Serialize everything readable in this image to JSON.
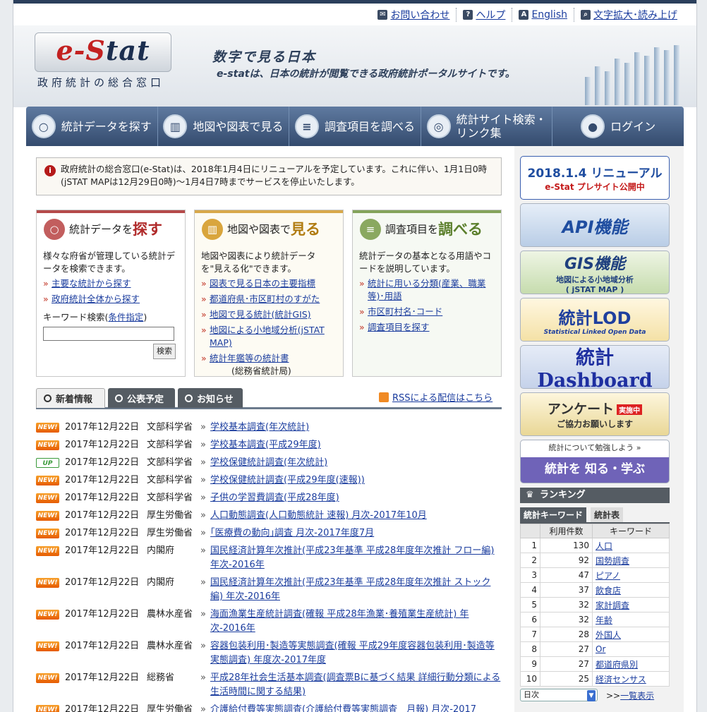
{
  "util": [
    {
      "icon": "✉",
      "label": "お問い合わせ"
    },
    {
      "icon": "?",
      "label": "ヘルプ"
    },
    {
      "icon": "A",
      "label": "English"
    },
    {
      "icon": "⌕",
      "label": "文字拡大･読み上げ"
    }
  ],
  "header": {
    "logo_text_pre": "e-S",
    "logo_text_post": "tat",
    "logo_sub": "政府統計の総合窓口",
    "tagline": "数字で見る日本",
    "tagline2": "e-statは、日本の統計が閲覧できる政府統計ポータルサイトです。"
  },
  "nav": [
    {
      "icon": "search-icon",
      "glyph": "○",
      "label": "統計データを探す"
    },
    {
      "icon": "map-chart-icon",
      "glyph": "▥",
      "label": "地図や図表で見る"
    },
    {
      "icon": "survey-icon",
      "glyph": "≡",
      "label": "調査項目を調べる"
    },
    {
      "icon": "globe-icon",
      "glyph": "◎",
      "label": "統計サイト検索・\nリンク集"
    },
    {
      "icon": "user-icon",
      "glyph": "●",
      "label": "ログイン"
    }
  ],
  "notice": {
    "icon": "i",
    "text": "政府統計の総合窓口(e-Stat)は、2018年1月4日にリニューアルを予定しています。これに伴い、1月1日0時(jSTAT MAPは12月29日0時)～1月4日7時までサービスを停止いたします。"
  },
  "box1": {
    "pre": "統計データを",
    "big": "探す",
    "desc": "様々な府省が管理している統計データを検索できます。",
    "links": [
      "主要な統計から探す",
      "政府統計全体から探す"
    ],
    "kw_label": "キーワード検索(",
    "kw_link": "条件指定",
    "kw_close": ")",
    "kw_button": "検索"
  },
  "box2": {
    "pre": "地図や図表で",
    "big": "見る",
    "desc": "地図や図表により統計データを\"見える化\"できます。",
    "links": [
      "図表で見る日本の主要指標",
      "都道府県･市区町村のすがた",
      "地図で見る統計(統計GIS)",
      "地図による小地域分析(jSTAT MAP)",
      "統計年鑑等の統計書"
    ],
    "note": "(総務省統計局)"
  },
  "box3": {
    "pre": "調査項目を",
    "big": "調べる",
    "desc": "統計データの基本となる用語やコードを説明しています。",
    "links": [
      "統計に用いる分類(産業、職業等)･用語",
      "市区町村名･コード",
      "調査項目を探す"
    ]
  },
  "tabs": [
    "新着情報",
    "公表予定",
    "お知らせ"
  ],
  "rss": "RSSによる配信はこちら",
  "news": [
    {
      "badge": "NEW!",
      "date": "2017年12月22日",
      "ministry": "文部科学省",
      "title": "学校基本調査(年次統計)"
    },
    {
      "badge": "NEW!",
      "date": "2017年12月22日",
      "ministry": "文部科学省",
      "title": "学校基本調査(平成29年度)"
    },
    {
      "badge": "UP",
      "date": "2017年12月22日",
      "ministry": "文部科学省",
      "title": "学校保健統計調査(年次統計)"
    },
    {
      "badge": "NEW!",
      "date": "2017年12月22日",
      "ministry": "文部科学省",
      "title": "学校保健統計調査(平成29年度(速報))"
    },
    {
      "badge": "NEW!",
      "date": "2017年12月22日",
      "ministry": "文部科学省",
      "title": "子供の学習費調査(平成28年度)"
    },
    {
      "badge": "NEW!",
      "date": "2017年12月22日",
      "ministry": "厚生労働省",
      "title": "人口動態調査(人口動態統計 速報) 月次-2017年10月"
    },
    {
      "badge": "NEW!",
      "date": "2017年12月22日",
      "ministry": "厚生労働省",
      "title": "｢医療費の動向｣調査 月次-2017年度7月"
    },
    {
      "badge": "NEW!",
      "date": "2017年12月22日",
      "ministry": "内閣府",
      "title": "国民経済計算年次推計(平成23年基準 平成28年度年次推計 フロー編) 年次-2016年"
    },
    {
      "badge": "NEW!",
      "date": "2017年12月22日",
      "ministry": "内閣府",
      "title": "国民経済計算年次推計(平成23年基準 平成28年度年次推計 ストック編) 年次-2016年"
    },
    {
      "badge": "NEW!",
      "date": "2017年12月22日",
      "ministry": "農林水産省",
      "title": "海面漁業生産統計調査(確報 平成28年漁業･養殖業生産統計) 年次-2016年"
    },
    {
      "badge": "NEW!",
      "date": "2017年12月22日",
      "ministry": "農林水産省",
      "title": "容器包装利用･製造等実態調査(確報 平成29年度容器包装利用･製造等実態調査) 年度次-2017年度"
    },
    {
      "badge": "NEW!",
      "date": "2017年12月22日",
      "ministry": "総務省",
      "title": "平成28年社会生活基本調査(調査票Bに基づく結果 詳細行動分類による生活時間に関する結果)"
    },
    {
      "badge": "NEW!",
      "date": "2017年12月22日",
      "ministry": "厚生労働省",
      "title": "介護給付費等実態調査(介護給付費等実態調査　月報) 月次-2017"
    }
  ],
  "side": {
    "ban1": {
      "l1": "2018.1.4 リニューアル",
      "l2": "e-Stat プレサイト公開中"
    },
    "ban2": "API機能",
    "ban3": {
      "l1": "GIS機能",
      "l2": "地図による小地域分析",
      "l3": "( jSTAT MAP )"
    },
    "ban4": {
      "l1": "統計LOD",
      "l2": "Statistical Linked Open Data"
    },
    "ban5": "統計 Dashboard",
    "ban6": {
      "l1": "アンケート",
      "tag": "実施中",
      "l2": "ご協力お願いします"
    },
    "ban7": {
      "l1": "統計について勉強しよう »",
      "l2": "統計を 知る・学ぶ"
    }
  },
  "ranking": {
    "title": "ランキング",
    "tab1": "統計キーワード",
    "tab2": "統計表",
    "col_count": "利用件数",
    "col_kw": "キーワード",
    "rows": [
      {
        "rank": "1",
        "count": "130",
        "kw": "人口"
      },
      {
        "rank": "2",
        "count": "92",
        "kw": "国勢調査"
      },
      {
        "rank": "3",
        "count": "47",
        "kw": "ピアノ"
      },
      {
        "rank": "4",
        "count": "37",
        "kw": "飲食店"
      },
      {
        "rank": "5",
        "count": "32",
        "kw": "家計調査"
      },
      {
        "rank": "6",
        "count": "32",
        "kw": "年齢"
      },
      {
        "rank": "7",
        "count": "28",
        "kw": "外国人"
      },
      {
        "rank": "8",
        "count": "27",
        "kw": "Or"
      },
      {
        "rank": "9",
        "count": "27",
        "kw": "都道府県別"
      },
      {
        "rank": "10",
        "count": "25",
        "kw": "経済センサス"
      }
    ],
    "period": "日次",
    "more_prefix": ">>",
    "more": "一覧表示"
  }
}
